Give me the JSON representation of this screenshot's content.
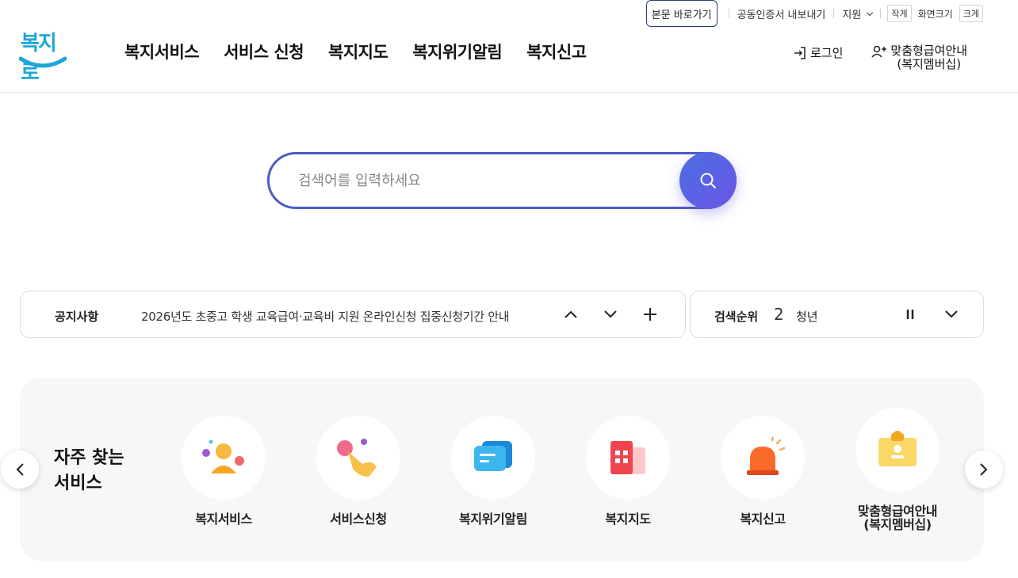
{
  "utility": {
    "skip_label": "본문 바로가기",
    "cert_label": "공동인증서 내보내기",
    "support_label": "지원",
    "size_small": "작게",
    "size_label": "화면크기",
    "size_large": "크게"
  },
  "header": {
    "logo_text": "복지로",
    "nav": [
      "복지서비스",
      "서비스 신청",
      "복지지도",
      "복지위기알림",
      "복지신고"
    ],
    "login_label": "로그인",
    "member_label_1": "맞춤형급여안내",
    "member_label_2": "(복지멤버십)"
  },
  "search": {
    "placeholder": "검색어를 입력하세요"
  },
  "notice": {
    "title": "공지사항",
    "text": "2026년도 초중고 학생 교육급여·교육비 지원 온라인신청 집중신청기간 안내"
  },
  "ranking": {
    "title": "검색순위",
    "number": "2",
    "keyword": "청년"
  },
  "frequent": {
    "title_1": "자주 찾는",
    "title_2": "서비스",
    "items": [
      {
        "label_1": "복지서비스",
        "label_2": ""
      },
      {
        "label_1": "서비스신청",
        "label_2": ""
      },
      {
        "label_1": "복지위기알림",
        "label_2": ""
      },
      {
        "label_1": "복지지도",
        "label_2": ""
      },
      {
        "label_1": "복지신고",
        "label_2": ""
      },
      {
        "label_1": "맞춤형급여안내",
        "label_2": "(복지멤버십)"
      }
    ]
  },
  "colors": {
    "brand": "#1ea6d9",
    "search_border": "#4a5cc9",
    "search_button": "#5a63e4"
  }
}
